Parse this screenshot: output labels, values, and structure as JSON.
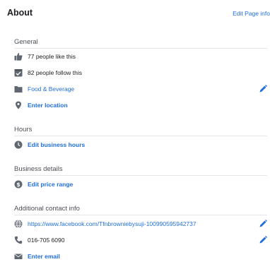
{
  "header": {
    "title": "About",
    "edit_link": "Edit Page info"
  },
  "sections": {
    "general": {
      "title": "General",
      "likes": "77 people like this",
      "follows": "82 people follow this",
      "category": "Food & Beverage",
      "location": "Enter location"
    },
    "hours": {
      "title": "Hours",
      "edit_hours": "Edit business hours"
    },
    "business": {
      "title": "Business details",
      "edit_price": "Edit price range"
    },
    "contact": {
      "title": "Additional contact info",
      "website": "https://www.facebook.com/Tfnbrowniebysuji-100990595942737",
      "phone": "016-705 6090",
      "email": "Enter email"
    }
  },
  "colors": {
    "link": "#216fdb",
    "icon": "#606770",
    "divider": "#e4e6eb",
    "text": "#1c1e21"
  }
}
